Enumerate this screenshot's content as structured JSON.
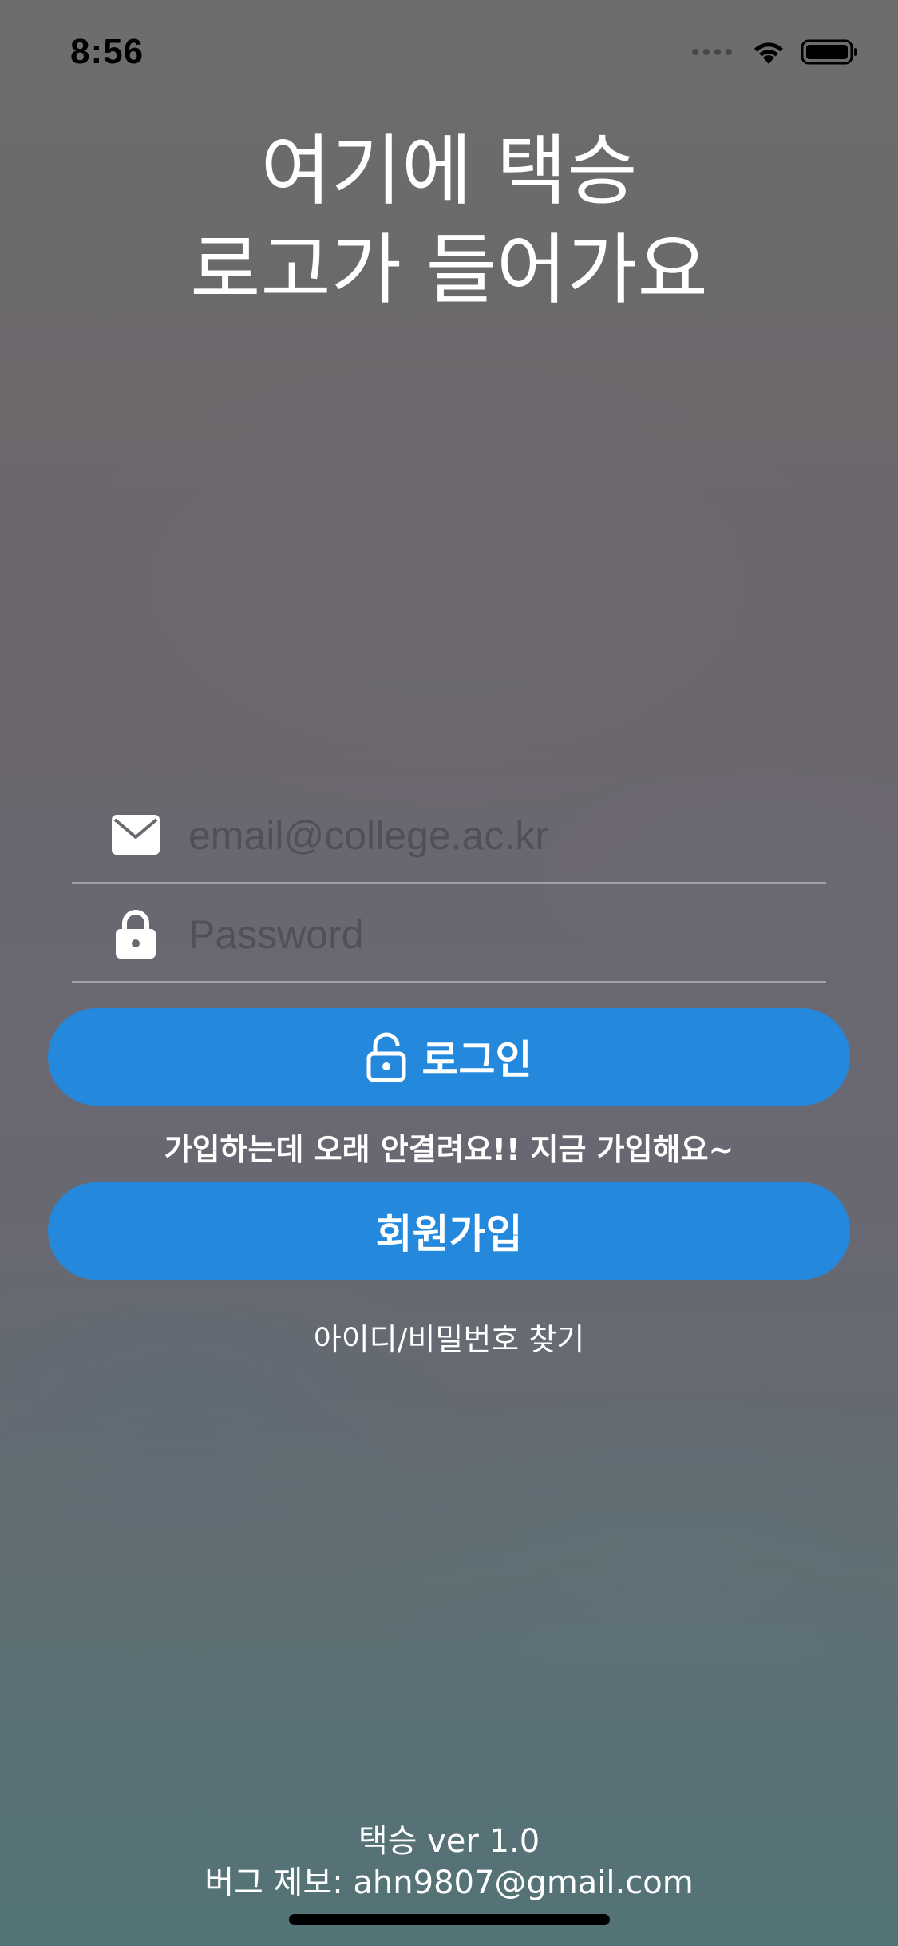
{
  "status_bar": {
    "time": "8:56",
    "signal_icon": "signal-dots-icon",
    "wifi_icon": "wifi-icon",
    "battery_icon": "battery-icon"
  },
  "logo": {
    "line1": "여기에 택승",
    "line2": "로고가 들어가요"
  },
  "login_form": {
    "email_placeholder": "email@college.ac.kr",
    "email_value": "",
    "email_icon": "envelope-icon",
    "password_placeholder": "Password",
    "password_value": "",
    "password_icon": "lock-icon",
    "login_button_label": "로그인",
    "login_button_icon": "unlock-icon"
  },
  "signup": {
    "prompt": "가입하는데 오래 안결려요!! 지금 가입해요~",
    "button_label": "회원가입"
  },
  "find_account_link": "아이디/비밀번호 찾기",
  "footer": {
    "version": "택승 ver 1.0",
    "bug_report": "버그 제보: ahn9807@gmail.com"
  },
  "colors": {
    "accent": "#2488dc",
    "text": "#ffffff",
    "divider": "#c8d2dc"
  }
}
